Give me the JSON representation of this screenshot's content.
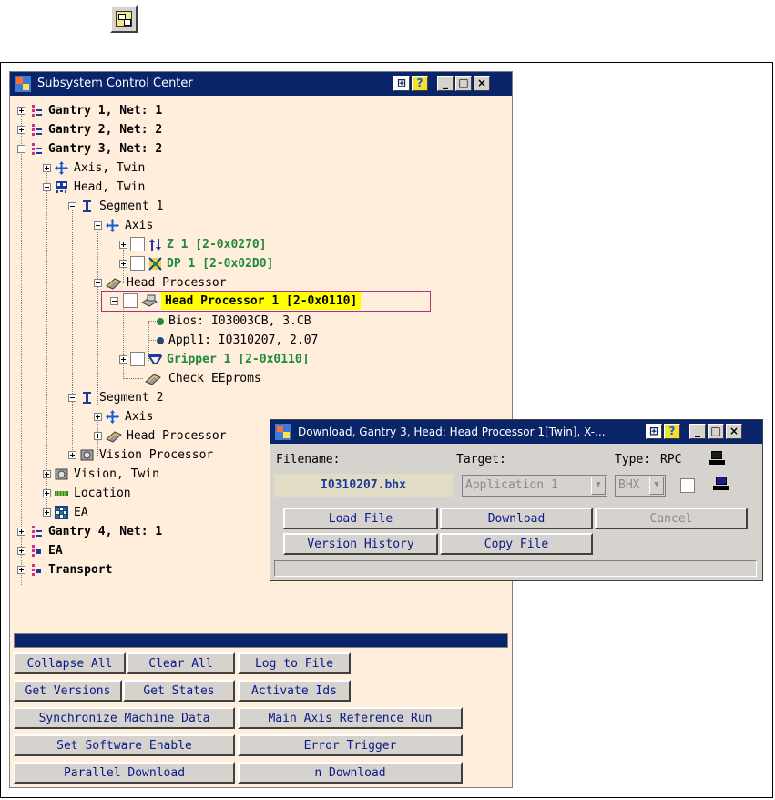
{
  "main_window": {
    "title": "Subsystem Control Center",
    "title_buttons": [
      "?",
      "_",
      "□",
      "×"
    ]
  },
  "tree": {
    "gantry1": "Gantry 1, Net: 1",
    "gantry2": "Gantry 2, Net: 2",
    "gantry3": "Gantry 3, Net: 2",
    "axis_twin": "Axis, Twin",
    "head_twin": "Head, Twin",
    "segment1": "Segment 1",
    "axis": "Axis",
    "z1": "Z 1 [2-0x0270]",
    "dp1": "DP 1 [2-0x02D0]",
    "head_processor": "Head Processor",
    "head_processor1": "Head Processor 1 [2-0x0110]",
    "bios": "Bios: I03003CB, 3.CB",
    "appl": "Appl1: I0310207, 2.07",
    "gripper1": "Gripper 1 [2-0x0110]",
    "check_eeproms": "Check EEproms",
    "segment2": "Segment 2",
    "axis2": "Axis",
    "head_processor2": "Head Processor",
    "vision_processor": "Vision Processor",
    "vision_twin": "Vision, Twin",
    "location": "Location",
    "ea": "EA",
    "gantry4": "Gantry 4, Net: 1",
    "ea_root": "EA",
    "transport": "Transport"
  },
  "buttons": {
    "collapse_all": "Collapse All",
    "clear_all": "Clear All",
    "log_to_file": "Log to File",
    "get_versions": "Get Versions",
    "get_states": "Get States",
    "activate_ids": "Activate Ids",
    "sync_machine": "Synchronize Machine Data",
    "main_axis_ref": "Main Axis Reference Run",
    "set_sw_enable": "Set Software Enable",
    "error_trigger": "Error Trigger",
    "parallel_download": "Parallel Download",
    "n_download": "n Download"
  },
  "download_dialog": {
    "title": "Download, Gantry 3, Head: Head Processor 1[Twin], X-...",
    "filename_label": "Filename:",
    "filename_value": "I0310207.bhx",
    "target_label": "Target:",
    "target_value": "Application 1",
    "type_label": "Type:",
    "type_value": "BHX",
    "rpc_label": "RPC",
    "load_file": "Load File",
    "download": "Download",
    "cancel": "Cancel",
    "version_history": "Version History",
    "copy_file": "Copy File"
  },
  "colors": {
    "titlebar": "#0a246a",
    "tree_background": "#ffeedc",
    "highlight": "#ffff00",
    "highlight_border": "#b0307a",
    "green_text": "#1f8a3a",
    "button_text": "#0a1a8a"
  },
  "icons": [
    "tree-overview-icon",
    "app-logo-icon",
    "gantry-icon",
    "axis-icon",
    "head-icon",
    "segment-icon",
    "z-axis-icon",
    "dp-icon",
    "processor-icon",
    "status-dot-icon",
    "gripper-icon",
    "eeprom-icon",
    "vision-icon",
    "location-icon",
    "ea-icon",
    "pc-icon"
  ]
}
